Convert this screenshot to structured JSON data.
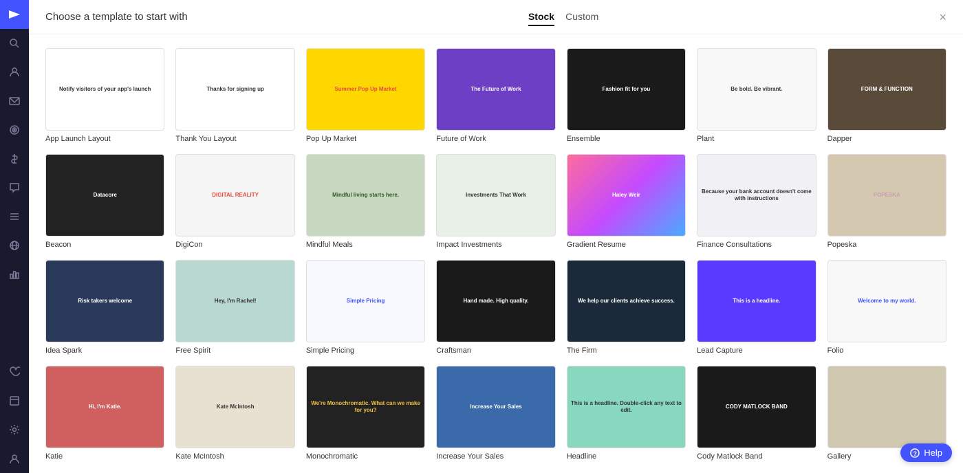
{
  "sidebar": {
    "nav_button_label": "▶",
    "icons": [
      {
        "name": "search-icon",
        "symbol": "🔍"
      },
      {
        "name": "contacts-icon",
        "symbol": "👥"
      },
      {
        "name": "email-icon",
        "symbol": "✉"
      },
      {
        "name": "target-icon",
        "symbol": "◎"
      },
      {
        "name": "dollar-icon",
        "symbol": "$"
      },
      {
        "name": "chat-icon",
        "symbol": "💬"
      },
      {
        "name": "list-icon",
        "symbol": "☰"
      },
      {
        "name": "globe-icon",
        "symbol": "○"
      },
      {
        "name": "chart-icon",
        "symbol": "📊"
      },
      {
        "name": "heart-icon",
        "symbol": "♡"
      },
      {
        "name": "pages-icon",
        "symbol": "⬜"
      },
      {
        "name": "settings-icon",
        "symbol": "⚙"
      },
      {
        "name": "user-icon",
        "symbol": "👤"
      }
    ]
  },
  "header": {
    "title": "Choose a template to start with",
    "tabs": [
      {
        "label": "Stock",
        "active": true
      },
      {
        "label": "Custom",
        "active": false
      }
    ],
    "close_label": "×"
  },
  "templates": [
    {
      "id": "app-launch",
      "name": "App Launch Layout",
      "bg": "#ffffff",
      "class": "t-app-launch",
      "text": "Notify visitors of your app's launch",
      "text_color": "#333"
    },
    {
      "id": "thank-you",
      "name": "Thank You Layout",
      "bg": "#ffffff",
      "class": "t-thank-you",
      "text": "Thanks for signing up",
      "text_color": "#333"
    },
    {
      "id": "popup",
      "name": "Pop Up Market",
      "bg": "#ffd700",
      "class": "t-popup",
      "text": "Summer Pop Up Market",
      "text_color": "#e74c3c"
    },
    {
      "id": "future",
      "name": "Future of Work",
      "bg": "#6c3fc5",
      "class": "t-future",
      "text": "The Future of Work",
      "text_color": "#fff"
    },
    {
      "id": "ensemble",
      "name": "Ensemble",
      "bg": "#1a1a1a",
      "class": "t-ensemble",
      "text": "Fashion fit for you",
      "text_color": "#fff"
    },
    {
      "id": "plant",
      "name": "Plant",
      "bg": "#f8f8f8",
      "class": "t-plant",
      "text": "Be bold. Be vibrant.",
      "text_color": "#333"
    },
    {
      "id": "dapper",
      "name": "Dapper",
      "bg": "#5a4a3a",
      "class": "t-dapper",
      "text": "FORM & FUNCTION",
      "text_color": "#fff"
    },
    {
      "id": "beacon",
      "name": "Beacon",
      "bg": "#222",
      "class": "t-beacon",
      "text": "Datacore",
      "text_color": "#fff"
    },
    {
      "id": "digicon",
      "name": "DigiCon",
      "bg": "#f5f5f5",
      "class": "t-digicon",
      "text": "DIGITAL REALITY",
      "text_color": "#e74c3c"
    },
    {
      "id": "mindful",
      "name": "Mindful Meals",
      "bg": "#c8d8c0",
      "class": "t-mindful",
      "text": "Mindful living starts here.",
      "text_color": "#2d5a27"
    },
    {
      "id": "impact",
      "name": "Impact Investments",
      "bg": "#e8f0e8",
      "class": "t-impact",
      "text": "Investments That Work",
      "text_color": "#333"
    },
    {
      "id": "gradient",
      "name": "Gradient Resume",
      "bg": "linear-gradient(135deg,#ff6b9d,#c44bff,#4baaff)",
      "class": "t-gradient",
      "text": "Haley Weir",
      "text_color": "#fff"
    },
    {
      "id": "finance",
      "name": "Finance Consultations",
      "bg": "#f0f0f5",
      "class": "t-finance",
      "text": "Because your bank account doesn't come with instructions",
      "text_color": "#333"
    },
    {
      "id": "popeska",
      "name": "Popeska",
      "bg": "#d4c8b0",
      "class": "t-popeska",
      "text": "POPESKA",
      "text_color": "#c8a0b0"
    },
    {
      "id": "idea-spark",
      "name": "Idea Spark",
      "bg": "#2a3a5a",
      "class": "t-idea-spark",
      "text": "Risk takers welcome",
      "text_color": "#fff"
    },
    {
      "id": "free-spirit",
      "name": "Free Spirit",
      "bg": "#b8d8d0",
      "class": "t-free-spirit",
      "text": "Hey, I'm Rachel!",
      "text_color": "#333"
    },
    {
      "id": "simple-pricing",
      "name": "Simple Pricing",
      "bg": "#f8f8ff",
      "class": "t-simple-pricing",
      "text": "Simple Pricing",
      "text_color": "#4353ff"
    },
    {
      "id": "craftsman",
      "name": "Craftsman",
      "bg": "#1a1a1a",
      "class": "t-craftsman",
      "text": "Hand made. High quality.",
      "text_color": "#fff"
    },
    {
      "id": "firm",
      "name": "The Firm",
      "bg": "#1a2a3a",
      "class": "t-firm",
      "text": "We help our clients achieve success.",
      "text_color": "#fff"
    },
    {
      "id": "lead-capture",
      "name": "Lead Capture",
      "bg": "#5a3aff",
      "class": "t-lead-capture",
      "text": "This is a headline.",
      "text_color": "#fff"
    },
    {
      "id": "folio",
      "name": "Folio",
      "bg": "#f8f8f8",
      "class": "t-folio",
      "text": "Welcome to my world.",
      "text_color": "#4353ff"
    },
    {
      "id": "katie",
      "name": "Katie",
      "bg": "#d06060",
      "class": "t-katie",
      "text": "Hi, I'm Katie.",
      "text_color": "#fff"
    },
    {
      "id": "kate",
      "name": "Kate McIntosh",
      "bg": "#e8e0d0",
      "class": "t-kate",
      "text": "Kate McIntosh",
      "text_color": "#333"
    },
    {
      "id": "monochromatic",
      "name": "Monochromatic",
      "bg": "#222",
      "class": "t-monochromatic",
      "text": "We're Monochromatic. What can we make for you?",
      "text_color": "#f0c040"
    },
    {
      "id": "increase-sales",
      "name": "Increase Your Sales",
      "bg": "#3a6aaa",
      "class": "t-increase-sales",
      "text": "Increase Your Sales",
      "text_color": "#fff"
    },
    {
      "id": "headline",
      "name": "Headline",
      "bg": "#88d8c0",
      "class": "t-headline",
      "text": "This is a headline. Double-click any text to edit.",
      "text_color": "#333"
    },
    {
      "id": "cody",
      "name": "Cody Matlock Band",
      "bg": "#1a1a1a",
      "class": "t-cody",
      "text": "CODY MATLOCK BAND",
      "text_color": "#fff"
    },
    {
      "id": "last",
      "name": "Gallery",
      "bg": "#d0c8b0",
      "class": "t-last",
      "text": "",
      "text_color": "#333"
    }
  ],
  "help": {
    "label": "Help"
  }
}
